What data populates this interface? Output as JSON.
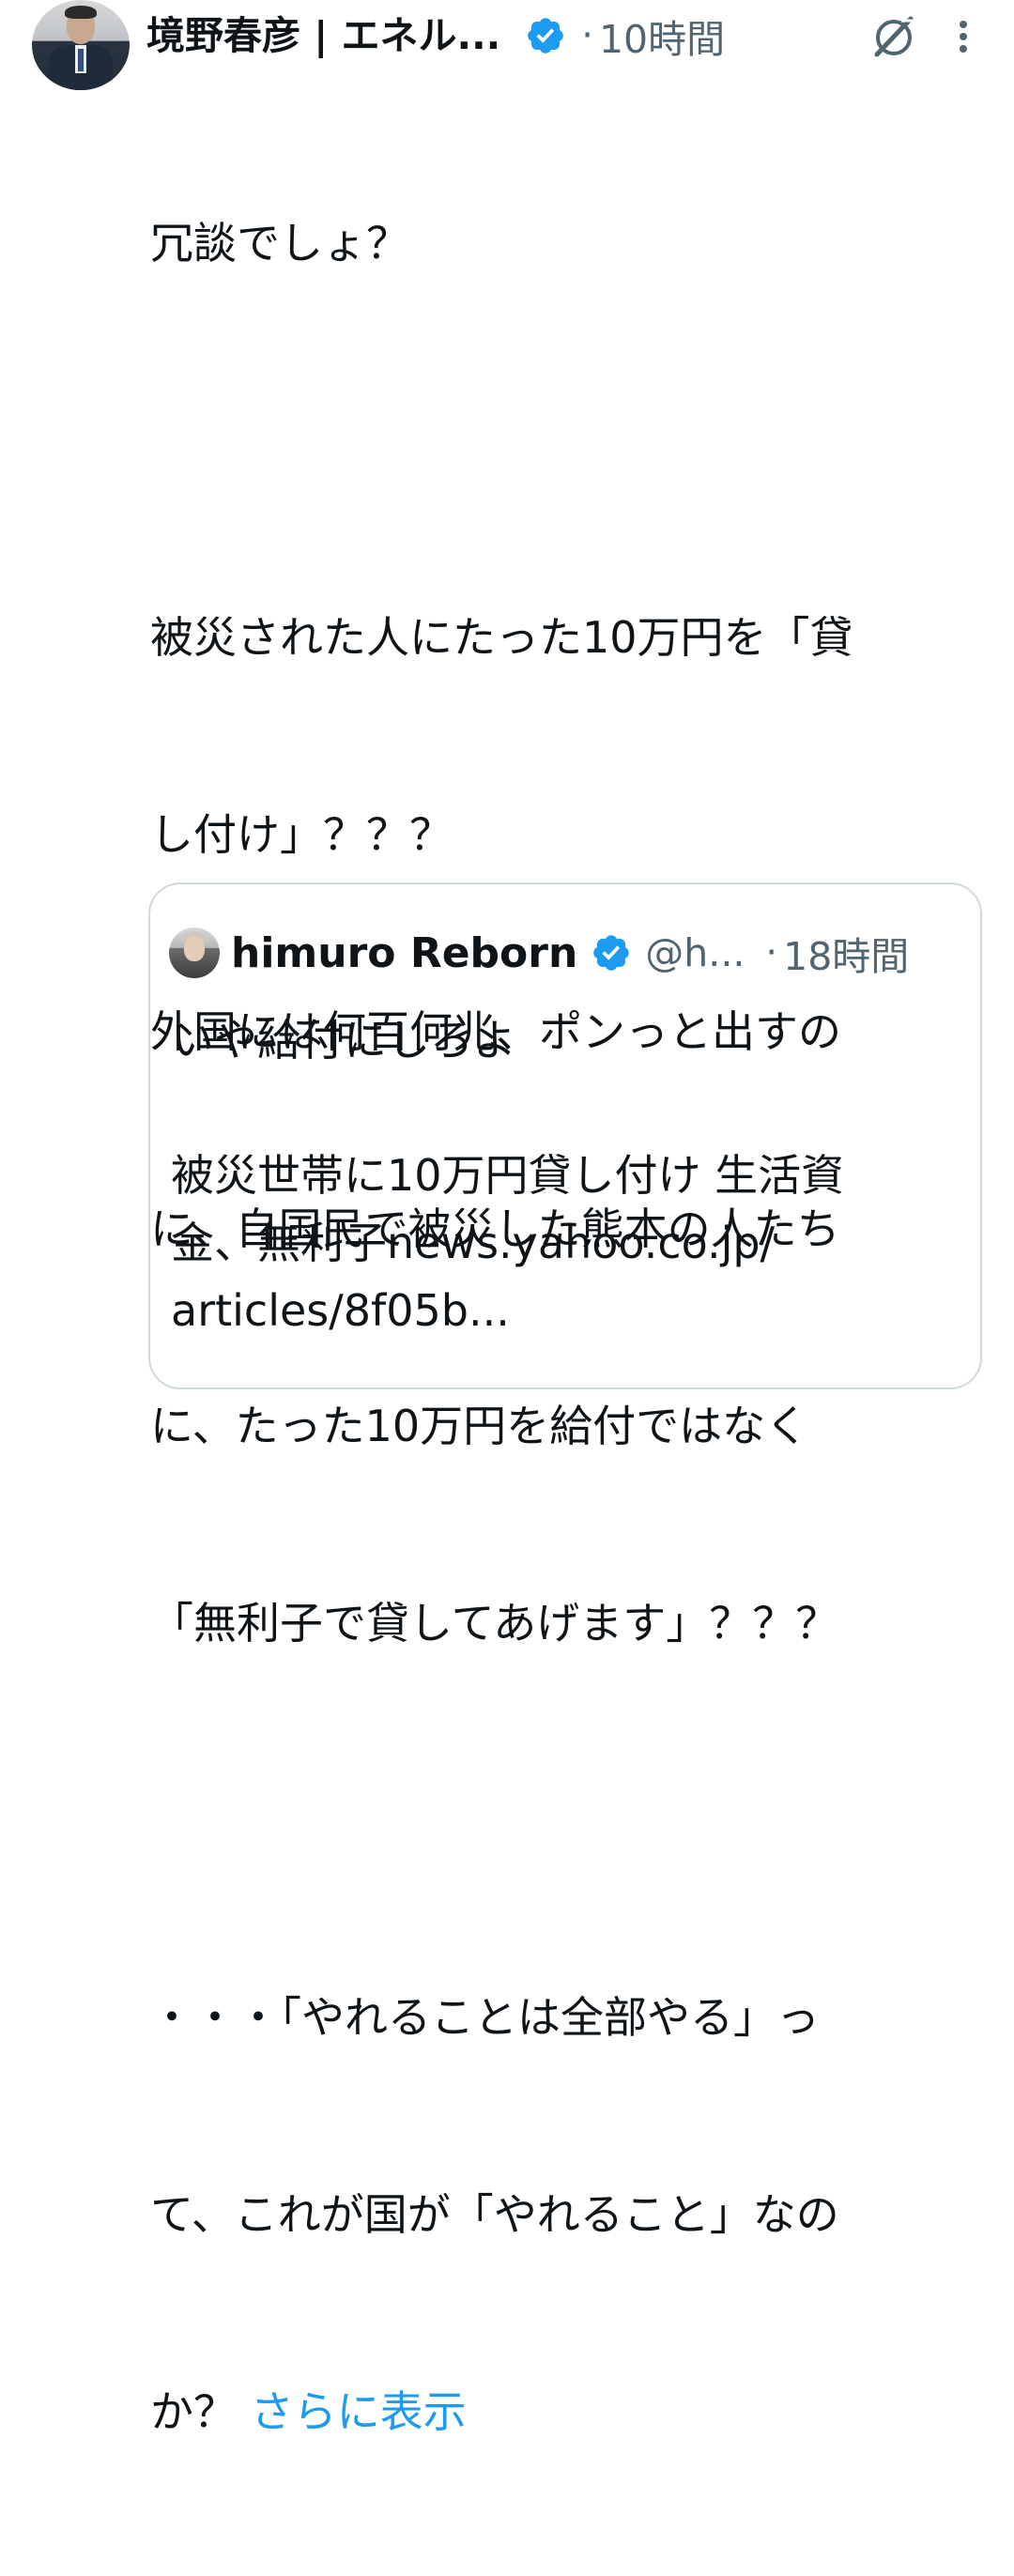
{
  "post": {
    "author_name": "境野春彦 | エネル...",
    "separator": "·",
    "time": "10時間",
    "lines": [
      "冗談でしょ？",
      "",
      "被災された人にたった10万円を「貸",
      "し付け」？？？",
      "外国には何百何兆、ポンっと出すの",
      "に、自国民で被災した熊本の人たち",
      "に、たった10万円を給付ではなく",
      "「無利子で貸してあげます」？？？",
      "",
      "・・・「やれることは全部やる」っ",
      "て、これが国が「やれること」なの"
    ],
    "last_line_prefix": "か？ ",
    "show_more": "さらに表示"
  },
  "quote": {
    "author_name": "himuro Reborn",
    "handle": "@h...",
    "separator": "·",
    "time": "18時間",
    "lines": [
      "いや給付にしろよ",
      "",
      "被災世帯に10万円貸し付け 生活資",
      "金、無利子news.yahoo.co.jp/",
      "articles/8f05b..."
    ]
  },
  "icons": {
    "verified": "verified-badge-icon",
    "grok": "grok-icon",
    "more": "more-vertical-icon"
  },
  "colors": {
    "link": "#1d9bf0",
    "verified": "#1d9bf0",
    "secondary_text": "#536471",
    "border": "#cfd9de"
  }
}
